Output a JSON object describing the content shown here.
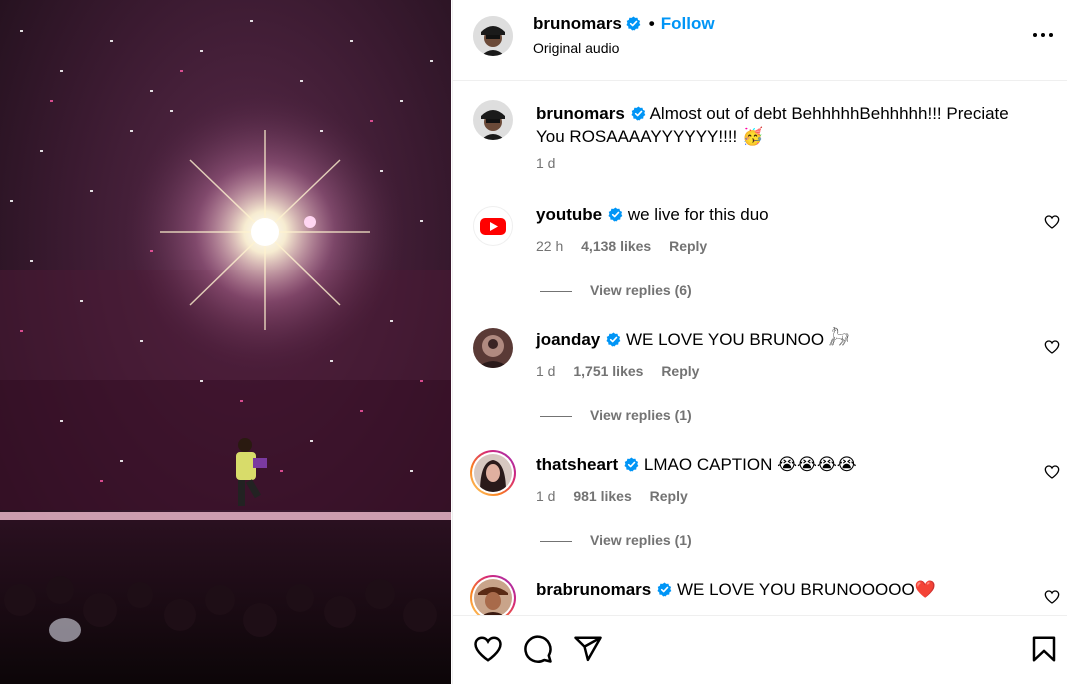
{
  "media": {
    "description_icon": "concert-photo"
  },
  "post": {
    "username": "brunomars",
    "follow_label": "Follow",
    "subtitle": "Original audio",
    "more_icon": "more-options-icon"
  },
  "caption": {
    "username": "brunomars",
    "text": "Almost out of debt BehhhhhBehhhhh!!! Preciate You ROSAAAAYYYYYY!!!!",
    "emoji": "🥳",
    "time": "1 d"
  },
  "comments": [
    {
      "username": "youtube",
      "text": "we live for this duo",
      "time": "22 h",
      "likes": "4,138 likes",
      "reply": "Reply",
      "view_replies": "View replies (6)"
    },
    {
      "username": "joanday",
      "text": "WE LOVE YOU BRUNOO 𓃗",
      "time": "1 d",
      "likes": "1,751 likes",
      "reply": "Reply",
      "view_replies": "View replies (1)"
    },
    {
      "username": "thatsheart",
      "text": "LMAO CAPTION",
      "emoji": "😭😭😭😭",
      "time": "1 d",
      "likes": "981 likes",
      "reply": "Reply",
      "view_replies": "View replies (1)"
    },
    {
      "username": "brabrunomars",
      "text": "WE LOVE YOU BRUNOOOOO",
      "emoji": "❤️"
    }
  ],
  "colors": {
    "accent": "#0095f6",
    "verified": "#0095f6",
    "muted": "#737373"
  }
}
